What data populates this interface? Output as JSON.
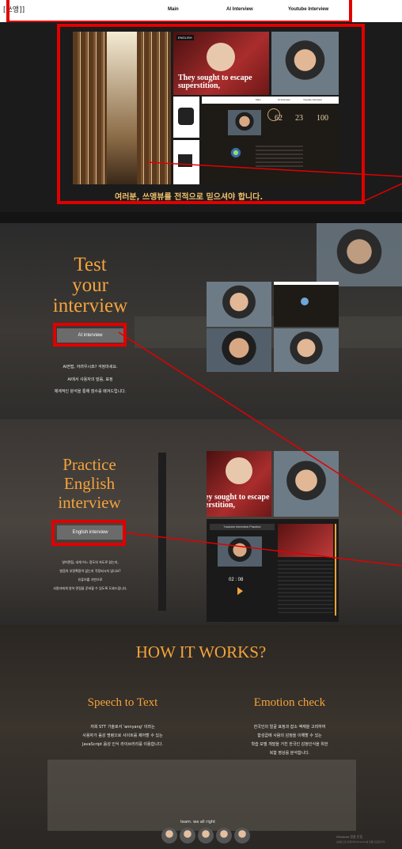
{
  "nav": {
    "logo": "[쓰앵]]",
    "main": "Main",
    "ai": "AI Interview",
    "youtube": "Youtube Interview"
  },
  "hero": {
    "caption": "여러분, 쓰앵뷰를 전적으로 믿으셔야 합니다.",
    "news_text": "They sought to escape superstition,",
    "news_brand": "ENGLISH",
    "stats": [
      "62",
      "23",
      "100"
    ],
    "preview_nav": [
      "Main",
      "AI Interview",
      "Youtube Interview"
    ]
  },
  "test": {
    "heading": [
      "Test",
      "your",
      "interview"
    ],
    "button": "AI interview",
    "desc": [
      "AI면접, 어려우시죠? 걱정마세요.",
      "AI에서 사용자의 발음, 표정",
      "체계적인 분석을 통해 점수를 매겨드립니다."
    ]
  },
  "practice": {
    "heading": [
      "Practice",
      "English",
      "interview"
    ],
    "button": "English interview",
    "desc": [
      "영어면접, 내게 어느 정도의 속도로 읽는지,",
      "발음의 부정확함이 없는지 걱정되시지 않나요?",
      "유튜브를 기반으로",
      "사용자에게 영어 면접을 준비할 수 있도록 도와드립니다."
    ],
    "news_text": "ey sought to escape erstition,",
    "panel_title": "Youtube Interview Practice",
    "timer": "02 : 08"
  },
  "how": {
    "title": "HOW IT WORKS?",
    "features": [
      {
        "title": "Speech to Text",
        "desc": [
          "저희 STT 기술로서 'annyang' 이라는",
          "사용자가 음성 명령으로 사이트를 제어할 수 있는",
          "JavaScript 음성 인식 라이브러리를 이용합니다."
        ]
      },
      {
        "title": "Emotion check",
        "desc": [
          "한국인의 얼굴 표정과 잡소 액재을 고려하여",
          "합성곱에 사람의 감정을 이해할 수 있는",
          "학습 모델 개발을 거친 한국인 감정인식을 위한",
          "복합 영상를 분석합니다."
        ]
      }
    ]
  },
  "footer": {
    "team": "team. we all right",
    "watermark": [
      "Windows 정품 인증",
      "[설정]으로 이동하여 Windows를 정품 인증합니다."
    ]
  },
  "colors": {
    "accent": "#f4a33c",
    "highlight": "#e00000",
    "caption": "#f1c06a"
  }
}
